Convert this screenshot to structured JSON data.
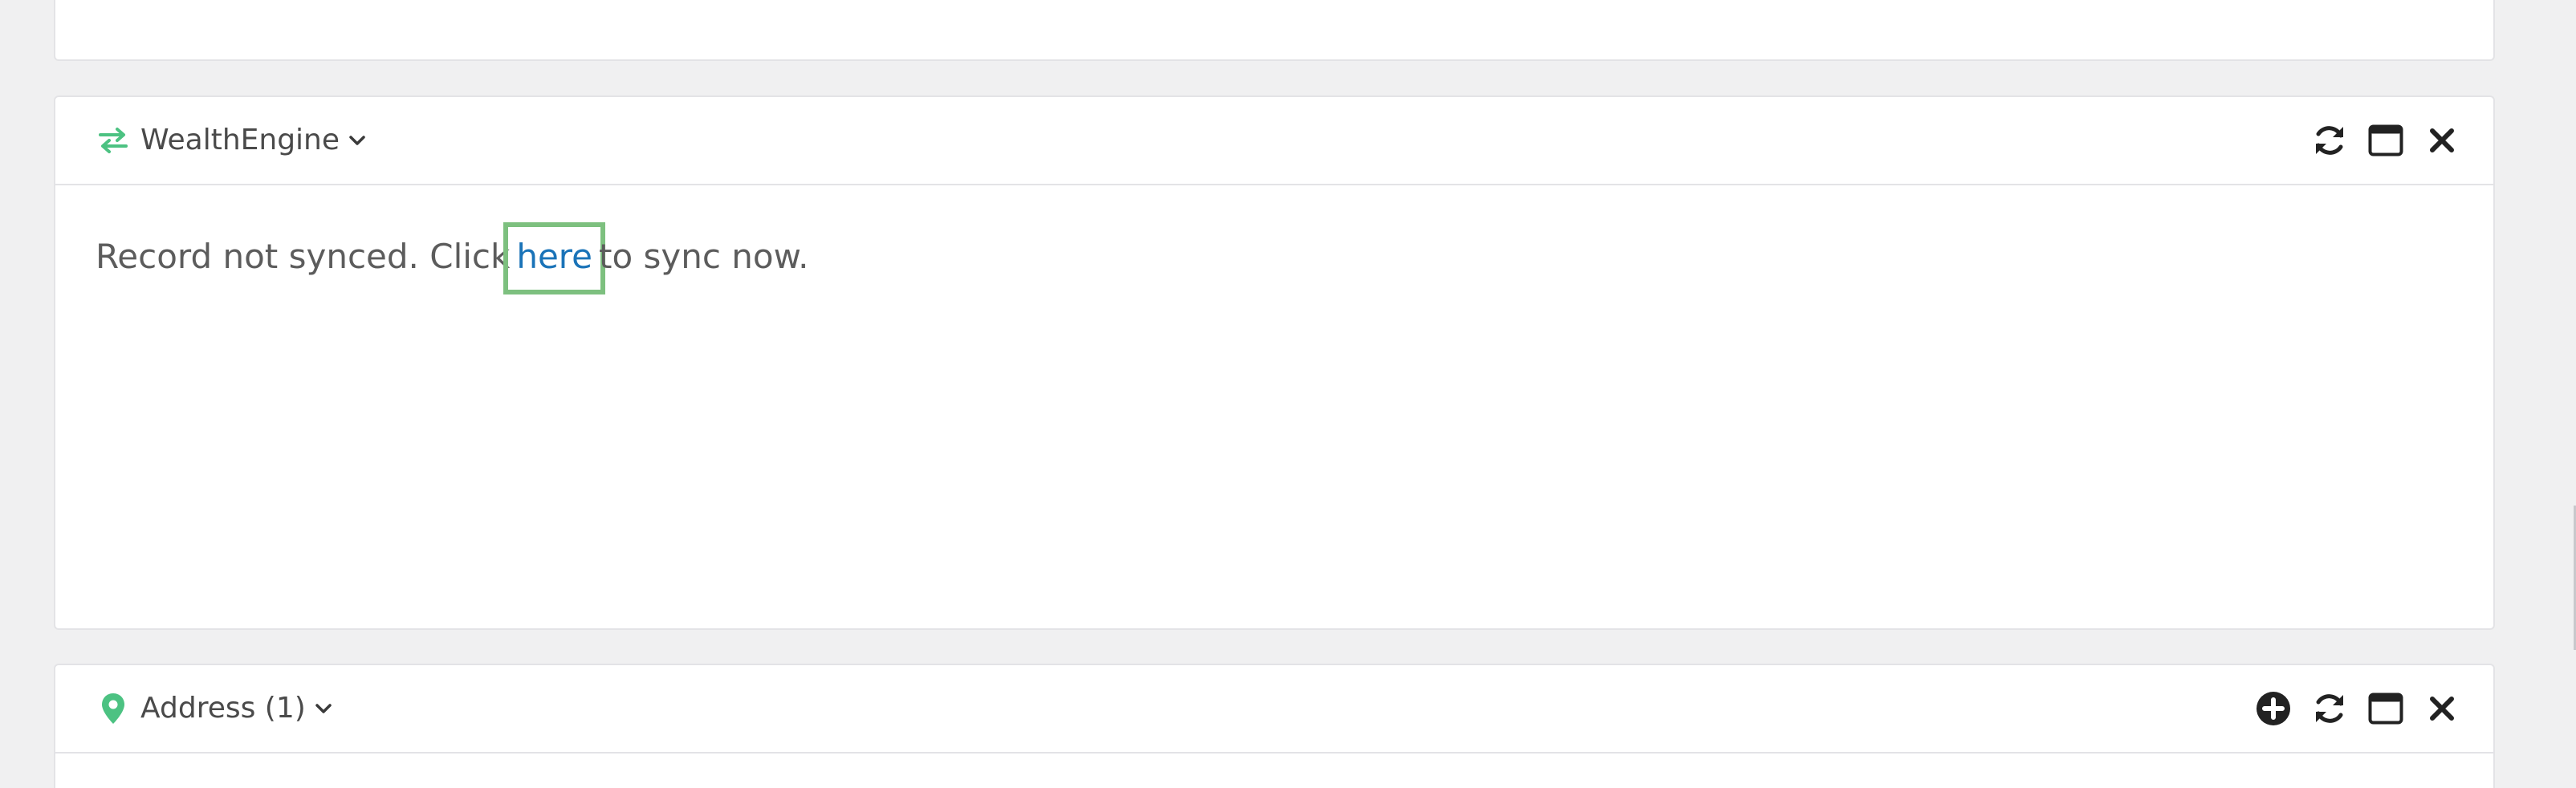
{
  "wealth_panel": {
    "title": "WealthEngine",
    "icon": "exchange-arrows-icon",
    "tools": [
      "refresh-icon",
      "window-maximize-icon",
      "close-icon"
    ],
    "message": {
      "before": "Record not synced. Click",
      "link": "here",
      "after": "to sync now."
    }
  },
  "address_panel": {
    "title": "Address (1)",
    "icon": "map-marker-icon",
    "tools": [
      "plus-circle-icon",
      "refresh-icon",
      "window-maximize-icon",
      "close-icon"
    ]
  },
  "colors": {
    "accent_green": "#4cc282",
    "link_blue": "#1a73b8",
    "highlight_green": "#7dc07f",
    "icon_dark": "#222222"
  }
}
